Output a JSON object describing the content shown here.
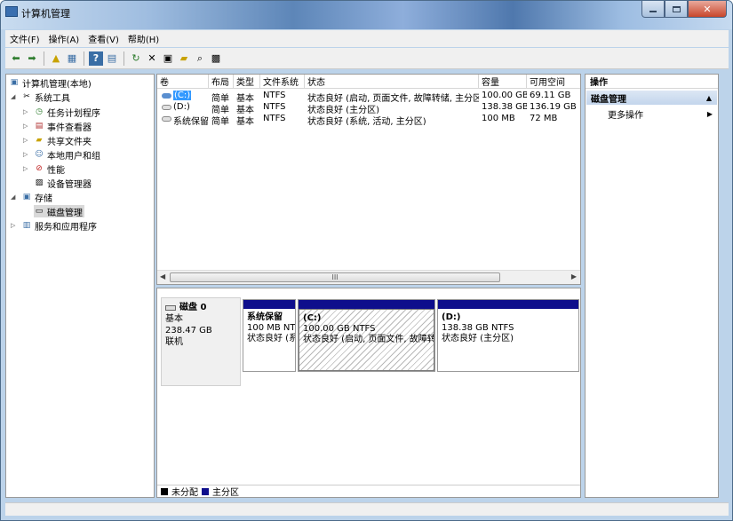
{
  "window": {
    "title": "计算机管理"
  },
  "menu": [
    "文件(F)",
    "操作(A)",
    "查看(V)",
    "帮助(H)"
  ],
  "tree": {
    "root": "计算机管理(本地)",
    "system_tools": "系统工具",
    "task_scheduler": "任务计划程序",
    "event_viewer": "事件查看器",
    "shared_folders": "共享文件夹",
    "local_users": "本地用户和组",
    "performance": "性能",
    "device_manager": "设备管理器",
    "storage": "存储",
    "disk_management": "磁盘管理",
    "services": "服务和应用程序"
  },
  "list": {
    "columns": [
      "卷",
      "布局",
      "类型",
      "文件系统",
      "状态",
      "容量",
      "可用空间"
    ],
    "rows": [
      [
        "(C:)",
        "简单",
        "基本",
        "NTFS",
        "状态良好 (启动, 页面文件, 故障转储, 主分区)",
        "100.00 GB",
        "69.11 GB"
      ],
      [
        "(D:)",
        "简单",
        "基本",
        "NTFS",
        "状态良好 (主分区)",
        "138.38 GB",
        "136.19 GB"
      ],
      [
        "系统保留",
        "简单",
        "基本",
        "NTFS",
        "状态良好 (系统, 活动, 主分区)",
        "100 MB",
        "72 MB"
      ]
    ],
    "scroll_mark": "III"
  },
  "disk": {
    "name": "磁盘 0",
    "type": "基本",
    "size": "238.47 GB",
    "state": "联机",
    "volumes": [
      {
        "name": "系统保留",
        "size": "100 MB NT",
        "status": "状态良好 (系"
      },
      {
        "name": "(C:)",
        "size": "100.00 GB NTFS",
        "status": "状态良好 (启动, 页面文件, 故障转"
      },
      {
        "name": "(D:)",
        "size": "138.38 GB NTFS",
        "status": "状态良好 (主分区)"
      }
    ]
  },
  "legend": {
    "unallocated": "未分配",
    "primary": "主分区",
    "colors": {
      "unallocated": "#000000",
      "primary": "#0e0e8c"
    }
  },
  "actions": {
    "header": "操作",
    "section": "磁盘管理",
    "more": "更多操作"
  }
}
